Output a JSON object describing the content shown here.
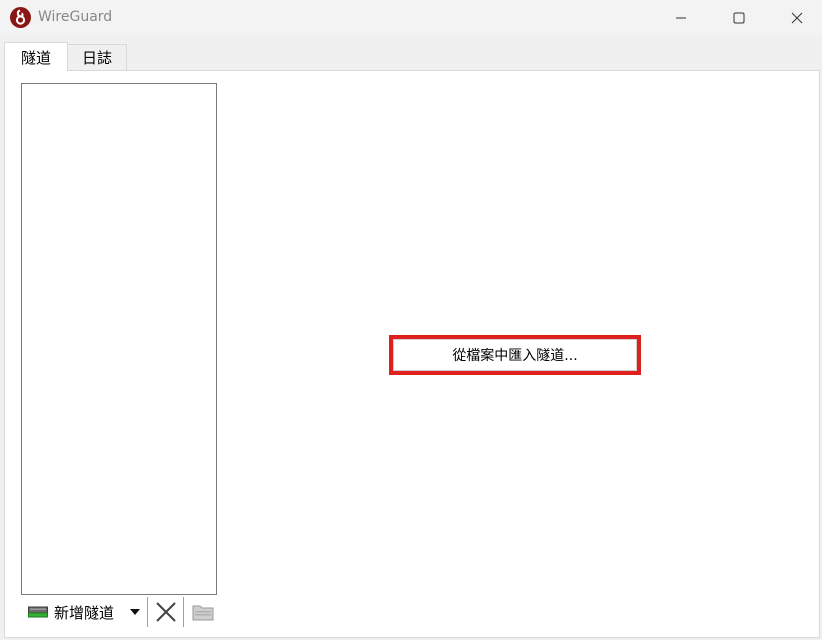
{
  "window": {
    "title": "WireGuard"
  },
  "tabs": [
    {
      "label": "隧道",
      "active": true
    },
    {
      "label": "日誌",
      "active": false
    }
  ],
  "tunnels": [],
  "toolbar": {
    "add_label": "新增隧道"
  },
  "main": {
    "import_label": "從檔案中匯入隧道..."
  },
  "colors": {
    "accent_red": "#e0201e",
    "logo_red": "#881716"
  },
  "icons": {
    "app": "wireguard-logo-icon",
    "add": "add-tunnel-icon",
    "dropdown": "chevron-down-icon",
    "delete": "delete-icon",
    "export": "export-icon"
  }
}
